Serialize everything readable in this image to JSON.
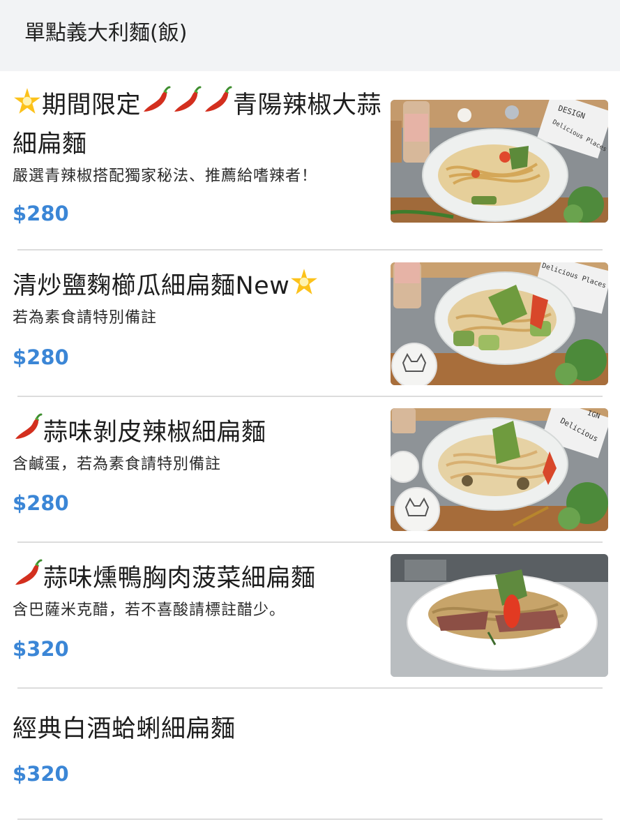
{
  "header": {
    "title": "單點義大利麵(飯)"
  },
  "items": [
    {
      "name_prefix": "期間限定",
      "name_suffix": "青陽辣椒大蒜細扁麵",
      "description": "嚴選青辣椒搭配獨家秘法、推薦給嗜辣者！",
      "price": "$280",
      "icons": [
        "star-icon",
        "chili-icon",
        "chili-icon",
        "chili-icon"
      ]
    },
    {
      "name": "清炒鹽麴櫛瓜細扁麵New",
      "description": "若為素食請特別備註",
      "price": "$280",
      "icons": [
        "star-icon"
      ]
    },
    {
      "name": "蒜味剝皮辣椒細扁麵",
      "description": "含鹹蛋，若為素食請特別備註",
      "price": "$280",
      "icons": [
        "chili-icon"
      ]
    },
    {
      "name": "蒜味燻鴨胸肉菠菜細扁麵",
      "description": "含巴薩米克醋，若不喜酸請標註醋少。",
      "price": "$320",
      "icons": [
        "chili-icon"
      ]
    },
    {
      "name": "經典白酒蛤蜊細扁麵",
      "price": "$320"
    }
  ],
  "photo_text": {
    "book_design": "DESIGN",
    "book_delicious": "Delicious Places",
    "book_delicious_short": "Delicious",
    "book_ign": "IGN"
  },
  "colors": {
    "price": "#3b86d6",
    "header_bg": "#f2f3f5",
    "divider": "#dcdcdc"
  }
}
